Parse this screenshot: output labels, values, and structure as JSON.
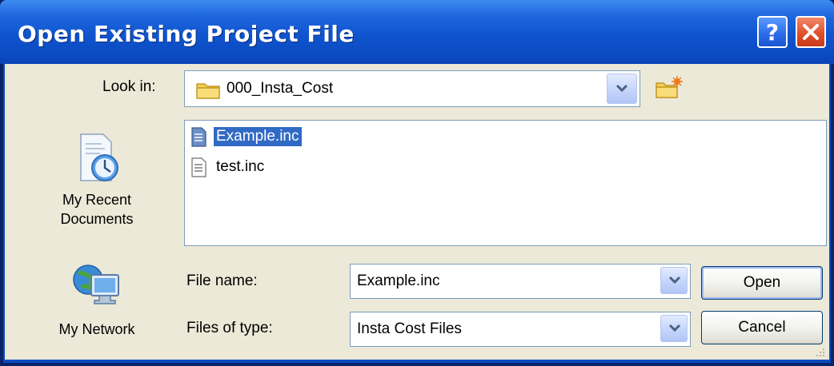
{
  "window": {
    "title": "Open Existing Project File",
    "help_label": "?"
  },
  "lookin": {
    "label": "Look in:",
    "value": "000_Insta_Cost"
  },
  "places": [
    {
      "label_line1": "My Recent",
      "label_line2": "Documents",
      "icon": "recent-documents-icon"
    },
    {
      "label_line1": "My Network",
      "label_line2": "",
      "icon": "network-icon"
    }
  ],
  "files": [
    {
      "name": "Example.inc",
      "selected": true
    },
    {
      "name": "test.inc",
      "selected": false
    }
  ],
  "filename": {
    "label": "File name:",
    "value": "Example.inc"
  },
  "filetype": {
    "label": "Files of type:",
    "value": "Insta Cost Files"
  },
  "buttons": {
    "open": "Open",
    "cancel": "Cancel"
  },
  "colors": {
    "titlebar": "#0b4bc2",
    "dialog_bg": "#ece9d8",
    "selection": "#316ac5"
  }
}
